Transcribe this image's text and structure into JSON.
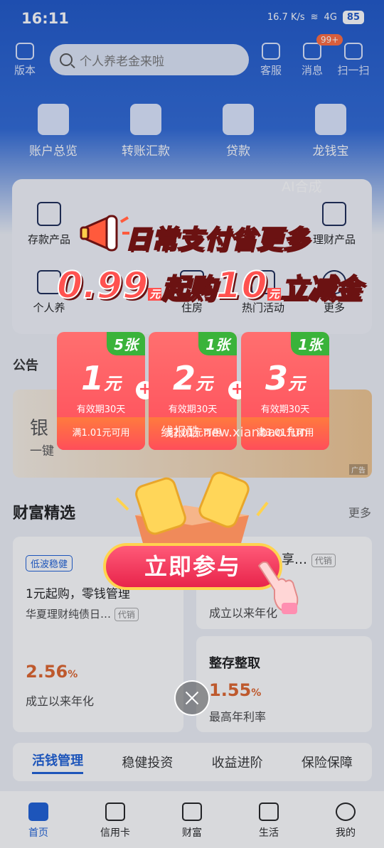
{
  "status": {
    "time": "16:11",
    "network": "16.7 K/s",
    "signal": "4G",
    "battery": "85"
  },
  "topbar": {
    "version_label": "版本",
    "search_placeholder": "个人养老金来啦",
    "service_label": "客服",
    "message_label": "消息",
    "message_badge": "99+",
    "scan_label": "扫一扫"
  },
  "quick": [
    {
      "label": "账户总览",
      "icon": "wallet-icon"
    },
    {
      "label": "转账汇款",
      "icon": "transfer-icon"
    },
    {
      "label": "贷款",
      "icon": "money-bag-icon"
    },
    {
      "label": "龙钱宝",
      "icon": "dragon-bag-icon"
    }
  ],
  "ai_tag": "AI合成",
  "menu": {
    "row1": [
      "存款产品",
      "",
      "",
      "",
      "理财产品"
    ],
    "row2": [
      "个人养",
      "",
      "住房",
      "热门活动",
      "更多"
    ]
  },
  "notice_label": "公告",
  "banner": {
    "title": "银",
    "subtitle": "一键",
    "ad": "广告"
  },
  "wealth": {
    "title": "财富精选",
    "more": "更多",
    "card1": {
      "tag": "低波稳健",
      "headline": "1元起购，零钱管理",
      "product": "华夏理财纯债日…",
      "agent": "代销",
      "rate": "2.56",
      "unit": "%",
      "rate_label": "成立以来年化"
    },
    "card2": {
      "title": "享…",
      "agent": "代销",
      "rate_label": "成立以来年化"
    },
    "card3": {
      "title": "整存整取",
      "rate": "1.55",
      "unit": "%",
      "rate_label": "最高年利率"
    }
  },
  "tabs": [
    "活钱管理",
    "稳健投资",
    "收益进阶",
    "保险保障"
  ],
  "bottomnav": [
    {
      "label": "首页",
      "icon": "home-icon"
    },
    {
      "label": "信用卡",
      "icon": "card-icon"
    },
    {
      "label": "财富",
      "icon": "wallet-icon"
    },
    {
      "label": "生活",
      "icon": "cup-icon"
    },
    {
      "label": "我的",
      "icon": "smile-icon"
    }
  ],
  "promo": {
    "line1": "日常支付省更多",
    "price": "0.99",
    "price_unit": "元",
    "mid_text": "起购",
    "amount": "10",
    "amount_unit": "元",
    "tail_text": "立减金",
    "coupons": [
      {
        "count": "5张",
        "amount": "1",
        "unit": "元",
        "validity": "有效期30天",
        "condition": "满1.01元可用"
      },
      {
        "count": "1张",
        "amount": "2",
        "unit": "元",
        "validity": "有效期30天",
        "condition": "满2.01元可用"
      },
      {
        "count": "1张",
        "amount": "3",
        "unit": "元",
        "validity": "有效期30天",
        "condition": "满3.01元可用"
      }
    ],
    "watermark": "线报酷 new.xianbao.fun",
    "join_label": "立即参与"
  },
  "colors": {
    "primary": "#1c5fd6",
    "promo_red": "#ff4e5a",
    "coupon_count_green": "#3ab33a",
    "rate_orange": "#e0632a"
  }
}
